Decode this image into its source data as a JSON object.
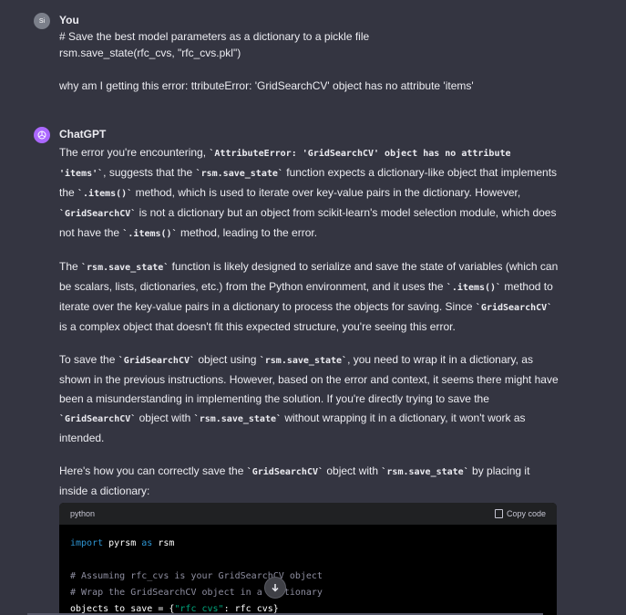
{
  "user_message": {
    "author": "You",
    "avatar_initials": "Si",
    "line1": "# Save the best model parameters as a dictionary to a pickle file",
    "line2": "rsm.save_state(rfc_cvs, \"rfc_cvs.pkl\")",
    "line3": "why am I getting this error: ttributeError: 'GridSearchCV' object has no attribute 'items'"
  },
  "assistant_message": {
    "author": "ChatGPT",
    "avatar_icon": "openai-logo-icon",
    "p1": {
      "t1": "The error you're encountering, ",
      "c1": "`AttributeError: 'GridSearchCV' object has no attribute 'items'`",
      "t2": ", suggests that the ",
      "c2": "`rsm.save_state`",
      "t3": " function expects a dictionary-like object that implements the ",
      "c3": "`.items()`",
      "t4": " method, which is used to iterate over key-value pairs in the dictionary. However, ",
      "c4": "`GridSearchCV`",
      "t5": " is not a dictionary but an object from scikit-learn's model selection module, which does not have the ",
      "c5": "`.items()`",
      "t6": " method, leading to the error."
    },
    "p2": {
      "t1": "The ",
      "c1": "`rsm.save_state`",
      "t2": " function is likely designed to serialize and save the state of variables (which can be scalars, lists, dictionaries, etc.) from the Python environment, and it uses the ",
      "c2": "`.items()`",
      "t3": " method to iterate over the key-value pairs in a dictionary to process the objects for saving. Since ",
      "c3": "`GridSearchCV`",
      "t4": " is a complex object that doesn't fit this expected structure, you're seeing this error."
    },
    "p3": {
      "t1": "To save the ",
      "c1": "`GridSearchCV`",
      "t2": " object using ",
      "c2": "`rsm.save_state`",
      "t3": ", you need to wrap it in a dictionary, as shown in the previous instructions. However, based on the error and context, it seems there might have been a misunderstanding in implementing the solution. If you're directly trying to save the ",
      "c3": "`GridSearchCV`",
      "t4": " object with ",
      "c4": "`rsm.save_state`",
      "t5": " without wrapping it in a dictionary, it won't work as intended."
    },
    "p4": {
      "t1": "Here's how you can correctly save the ",
      "c1": "`GridSearchCV`",
      "t2": " object with ",
      "c2": "`rsm.save_state`",
      "t3": " by placing it inside a dictionary:"
    }
  },
  "code_block": {
    "language": "python",
    "copy_label": "Copy code",
    "line1_kw1": "import",
    "line1_mod": " pyrsm ",
    "line1_kw2": "as",
    "line1_alias": " rsm",
    "line2": "# Assuming rfc_cvs is your GridSearchCV object",
    "line3": "# Wrap the GridSearchCV object in a dictionary",
    "line4_a": "objects_to_save = {",
    "line4_str": "\"rfc_cvs\"",
    "line4_b": ": rfc_cvs}"
  },
  "scroll_down_icon": "arrow-down-icon",
  "colors": {
    "background": "#343541",
    "code_background": "#000000",
    "code_header": "#202123",
    "keyword": "#2e95d3",
    "string": "#00a67d",
    "comment": "#8e8ea0",
    "assistant_avatar": "#ab68ff"
  }
}
